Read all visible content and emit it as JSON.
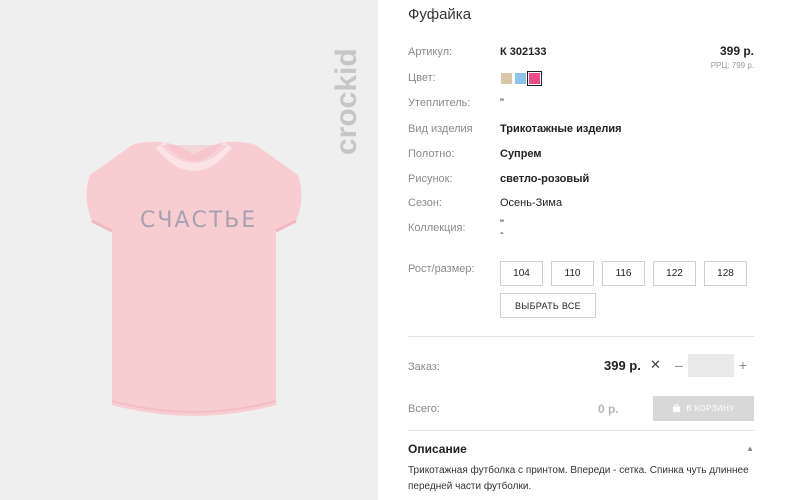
{
  "product": {
    "title": "Фуфайка",
    "brand": "crockid",
    "print_text": "СЧАСТЬЕ",
    "image_bg": "#efefef",
    "shirt_color": "#f8cdd2"
  },
  "attributes": {
    "article_label": "Артикул:",
    "article_value": "К 302133",
    "color_label": "Цвет:",
    "insulation_label": "Утеплитель:",
    "insulation_value": "\"",
    "type_label": "Вид изделия",
    "type_value": "Трикотажные изделия",
    "fabric_label": "Полотно:",
    "fabric_value": "Супрем",
    "pattern_label": "Рисунок:",
    "pattern_value": "светло-розовый",
    "season_label": "Сезон:",
    "season_value": "Осень-Зима",
    "collection_label": "Коллекция:",
    "collection_value": "\"\n-"
  },
  "pricing": {
    "price": "399 р.",
    "rrp": "РРЦ: 799 р."
  },
  "swatches": [
    {
      "name": "beige",
      "color": "#d8c6a8",
      "selected": false
    },
    {
      "name": "light-blue",
      "color": "#8cc4ec",
      "selected": false
    },
    {
      "name": "pink",
      "color": "#ec4d86",
      "selected": true
    }
  ],
  "sizes": {
    "label": "Рост/размер:",
    "options": [
      "104",
      "110",
      "116",
      "122",
      "128"
    ],
    "select_all": "ВЫБРАТЬ ВСЕ"
  },
  "order": {
    "label": "Заказ:",
    "price": "399 р.",
    "remove_symbol": "✕",
    "minus": "–",
    "plus": "+",
    "quantity": ""
  },
  "total": {
    "label": "Всего:",
    "value": "0 р.",
    "cart_button": "В КОРЗИНУ"
  },
  "description": {
    "title": "Описание",
    "collapse_symbol": "▲",
    "text": "Трикотажная футболка с принтом. Впереди - сетка. Спинка чуть длиннее передней части футболки."
  }
}
